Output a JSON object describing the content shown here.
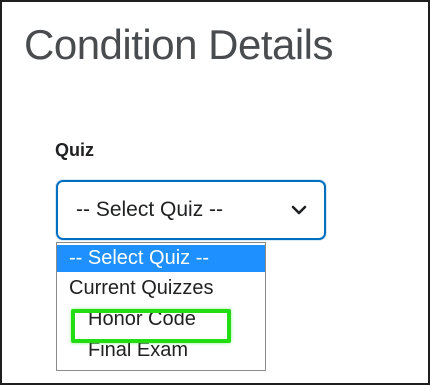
{
  "page": {
    "title": "Condition Details"
  },
  "quiz_field": {
    "label": "Quiz",
    "selected_value": "-- Select Quiz --",
    "options": [
      {
        "label": "-- Select Quiz --",
        "selected": true
      },
      {
        "label": "Current Quizzes",
        "group_header": true
      },
      {
        "label": "Honor Code",
        "highlighted": true
      },
      {
        "label": "Final Exam"
      }
    ]
  },
  "colors": {
    "select_border": "#006fbf",
    "selected_option_bg": "#1e90ff",
    "highlight": "#22dd11",
    "title_text": "#494c4e"
  },
  "icons": {
    "select_chevron": "chevron-down-icon"
  }
}
